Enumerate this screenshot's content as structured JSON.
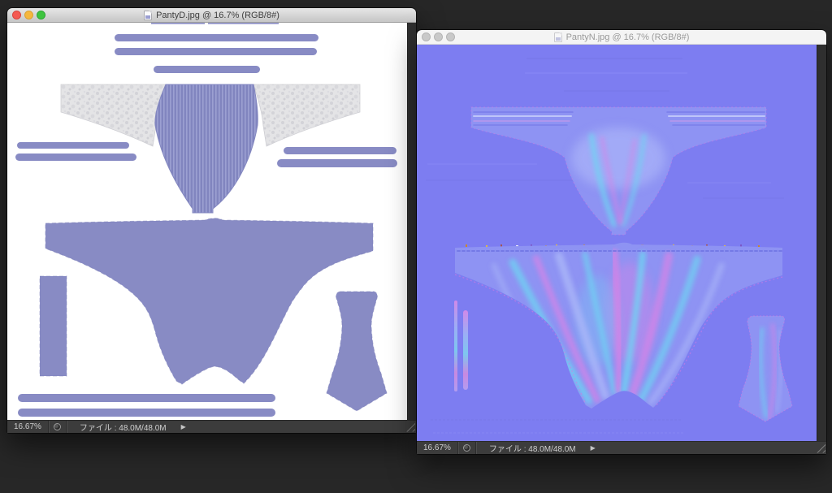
{
  "colors": {
    "desktop_bg": "#272727",
    "titlebar_active_top": "#e6e6e6",
    "titlebar_active_bottom": "#c6c6c6",
    "titlebar_inactive": "#f4f4f4",
    "title_text_active": "#3e3e3e",
    "title_text_inactive": "#9a9a9a",
    "statusbar_bg": "#3c3c3c",
    "statusbar_text": "#cfcfcf",
    "traffic_red": "#f45951",
    "traffic_yellow": "#f5b73d",
    "traffic_green": "#3ec43f",
    "traffic_inactive": "#c9c9c9",
    "canvas_white": "#ffffff",
    "texture_purple": "#888bc4",
    "texture_stripe_dark": "#8185bf",
    "texture_stripe_light": "#9ca0d2",
    "lace_gray": "#e4e4e6",
    "normal_bg": "#7d7df1",
    "normal_shape": "#8e93f3",
    "normal_cyan": "#6ed4f2",
    "normal_pink": "#d883e6",
    "normal_light": "#aab6f8"
  },
  "windows": [
    {
      "title": "PantyD.jpg @ 16.7% (RGB/8#)",
      "active": true,
      "statusbar": {
        "zoom": "16.67%",
        "file_label": "ファイル : 48.0M/48.0M",
        "arrow": "▶"
      }
    },
    {
      "title": "PantyN.jpg @ 16.7% (RGB/8#)",
      "active": false,
      "statusbar": {
        "zoom": "16.67%",
        "file_label": "ファイル : 48.0M/48.0M",
        "arrow": "▶"
      }
    }
  ]
}
